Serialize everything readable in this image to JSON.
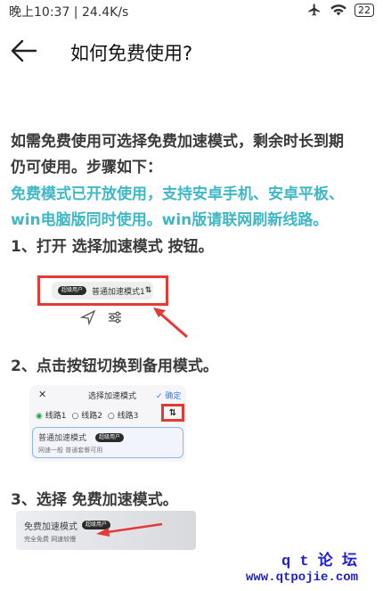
{
  "status_bar": {
    "time": "晚上10:37 | 24.4K/s",
    "battery": "22"
  },
  "header": {
    "title": "如何免费使用?"
  },
  "content": {
    "line1": "如需免费使用可选择免费加速模式，剩余时长到期",
    "line2": "仍可使用。步骤如下：",
    "line3": "免费模式已开放使用，支持安卓手机、安卓平板、",
    "line4": "win电脑版同时使用。win版请联网刷新线路。",
    "step1": "1、打开  选择加速模式  按钮。",
    "step2": "2、点击按钮切换到备用模式。",
    "step3": "3、选择  免费加速模式。"
  },
  "shot1": {
    "tag": "超级用户",
    "mode": "普通加速模式1"
  },
  "shot2": {
    "title": "选择加速模式",
    "confirm": "确定",
    "lines": [
      "线路1",
      "线路2",
      "线路3"
    ],
    "mode": "普通加速模式",
    "tag": "超级用户",
    "desc": "网速一般 普通套餐可用"
  },
  "shot3": {
    "mode": "免费加速模式",
    "tag": "超级用户",
    "desc": "完全免费 网速较慢"
  },
  "watermark": {
    "line1": "q t 论 坛",
    "line2": "www.qtpojie.com"
  },
  "colors": {
    "accent": "#3fb8c6",
    "highlight": "#e53935",
    "watermark": "#1e1ed8"
  }
}
